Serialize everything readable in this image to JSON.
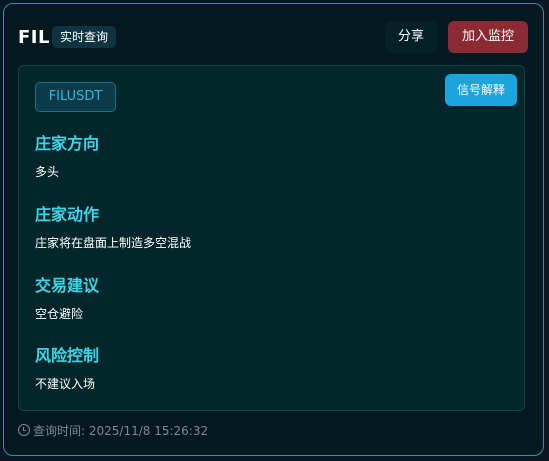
{
  "header": {
    "symbol": "FIL",
    "mode_badge": "实时查询",
    "share_label": "分享",
    "monitor_label": "加入监控"
  },
  "panel": {
    "symbol_badge": "FILUSDT",
    "explain_label": "信号解释",
    "sections": [
      {
        "title": "庄家方向",
        "value": "多头"
      },
      {
        "title": "庄家动作",
        "value": "庄家将在盘面上制造多空混战"
      },
      {
        "title": "交易建议",
        "value": "空仓避险"
      },
      {
        "title": "风险控制",
        "value": "不建议入场"
      }
    ]
  },
  "footer": {
    "query_time": "查询时间: 2025/11/8 15:26:32"
  },
  "colors": {
    "accent": "#1aa6dc",
    "section_title": "#3dd5e8",
    "danger_button": "#8a2b33",
    "border": "#2a90b4"
  }
}
